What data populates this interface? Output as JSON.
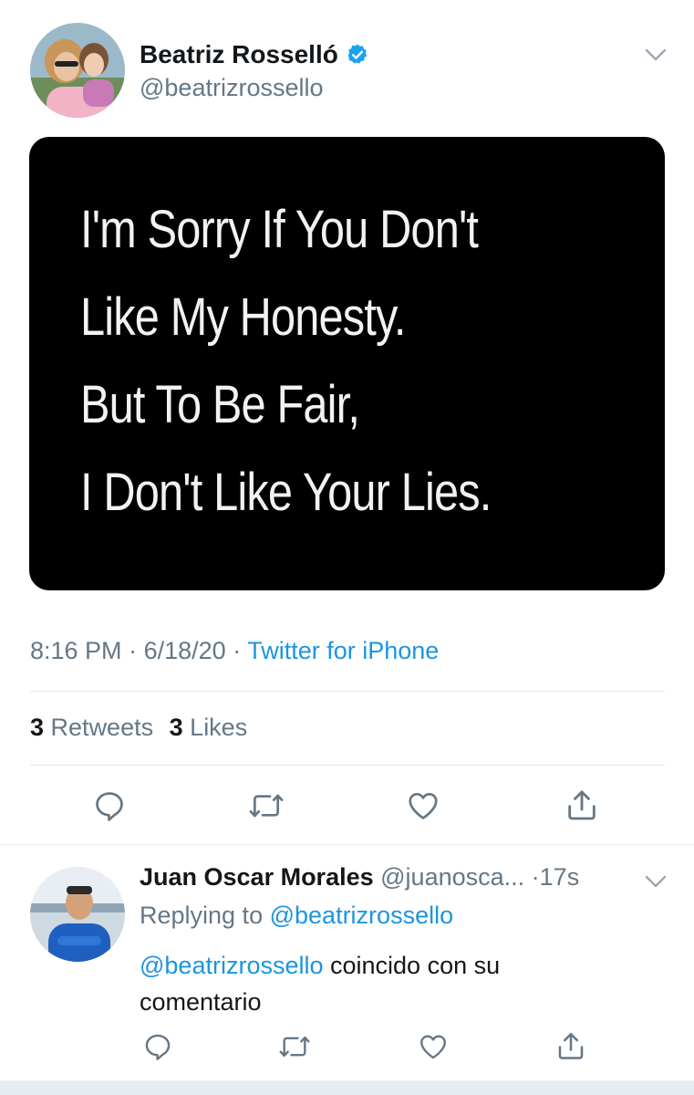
{
  "tweet": {
    "author_name": "Beatriz Rosselló",
    "author_handle": "@beatrizrossello",
    "image_text": {
      "line1": "I'm Sorry If You Don't",
      "line2": "Like My Honesty.",
      "line3": "But To Be Fair,",
      "line4": "I Don't Like Your Lies."
    },
    "time": "8:16 PM",
    "date": "6/18/20",
    "source": "Twitter for iPhone",
    "separator": "·",
    "retweets_count": "3",
    "retweets_label": "Retweets",
    "likes_count": "3",
    "likes_label": "Likes"
  },
  "reply": {
    "author_name": "Juan Oscar Morales",
    "author_handle": "@juanosca...",
    "age": "17s",
    "replying_label": "Replying to",
    "replying_handle": "@beatrizrossello",
    "mention": "@beatrizrossello",
    "body_line1": "coincido con su",
    "body_line2": "comentario"
  },
  "icons": {
    "verified": "verified-badge-icon",
    "more": "chevron-down-icon",
    "reply": "reply-icon",
    "retweet": "retweet-icon",
    "like": "heart-icon",
    "share": "share-icon"
  },
  "colors": {
    "accent": "#1b95e0",
    "verified": "#1da1f2",
    "muted": "#657786",
    "divider": "#e1e8ed"
  }
}
